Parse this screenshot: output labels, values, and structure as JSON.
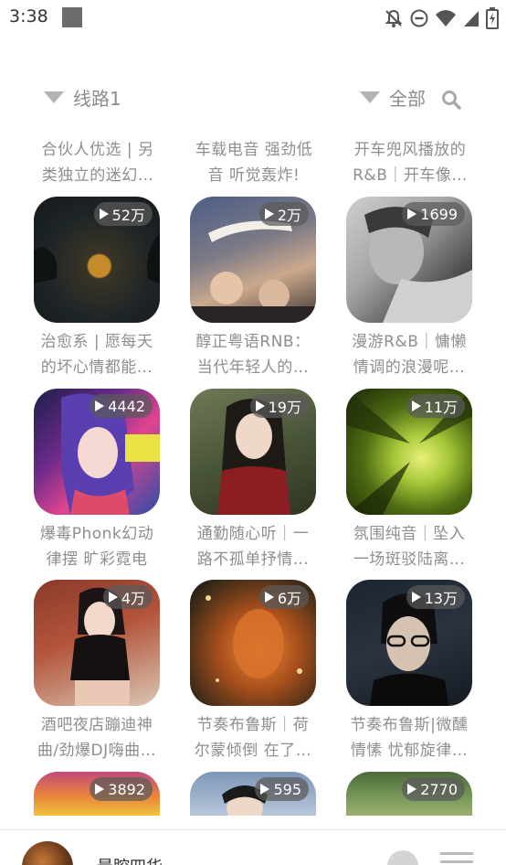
{
  "status_bar": {
    "time": "3:38"
  },
  "filter": {
    "route_label": "线路1",
    "category_label": "全部"
  },
  "top_partial_captions": [
    [
      "合伙人优选 | 另",
      "类独立的迷幻…"
    ],
    [
      "车载电音 强劲低",
      "音 听觉轰炸!"
    ],
    [
      "开车兜风播放的",
      "R&B｜开车像…"
    ]
  ],
  "playlists": [
    {
      "count": "52万",
      "line1": "治愈系 | 愿每天",
      "line2": "的坏心情都能…"
    },
    {
      "count": "2万",
      "line1": "醇正粤语RNB：",
      "line2": "当代年轻人的…"
    },
    {
      "count": "1699",
      "line1": "漫游R&B｜慵懒",
      "line2": "情调的浪漫呢…"
    },
    {
      "count": "4442",
      "line1": "爆毒Phonk幻动",
      "line2": "律摆 旷彩霓电"
    },
    {
      "count": "19万",
      "line1": "通勤随心听｜一",
      "line2": "路不孤单抒情…"
    },
    {
      "count": "11万",
      "line1": "氛围纯音｜坠入",
      "line2": "一场斑驳陆离…"
    },
    {
      "count": "4万",
      "line1": "酒吧夜店蹦迪神",
      "line2": "曲/劲爆DJ嗨曲…"
    },
    {
      "count": "6万",
      "line1": "节奏布鲁斯｜荷",
      "line2": "尔蒙倾倒 在了…"
    },
    {
      "count": "13万",
      "line1": "节奏布鲁斯|微醺",
      "line2": "情愫 忧郁旋律…"
    },
    {
      "count": "3892",
      "line1": "",
      "line2": ""
    },
    {
      "count": "595",
      "line1": "",
      "line2": ""
    },
    {
      "count": "2770",
      "line1": "",
      "line2": ""
    }
  ],
  "player": {
    "title": "最腔四华"
  },
  "icons": [
    "app-notification-icon",
    "notifications-off-icon",
    "do-not-disturb-icon",
    "wifi-icon",
    "signal-icon",
    "battery-charging-icon",
    "dropdown-triangle-icon",
    "search-icon",
    "play-icon",
    "pause-icon",
    "playlist-icon"
  ]
}
